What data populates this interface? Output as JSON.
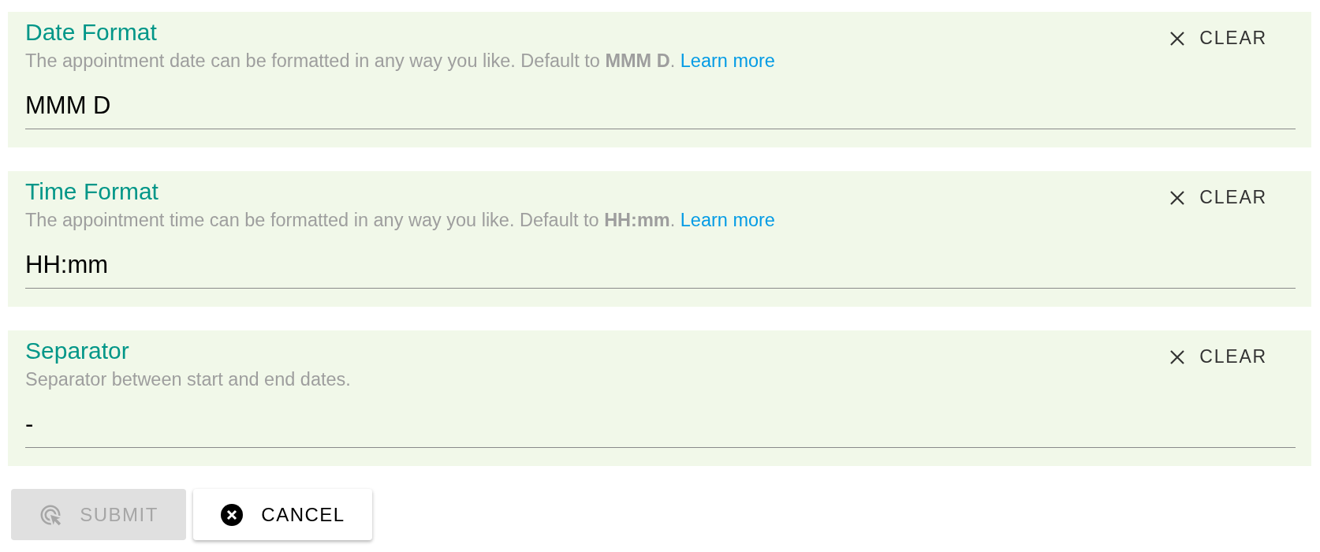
{
  "fields": [
    {
      "title": "Date Format",
      "description": "The appointment date can be formatted in any way you like. Default to **MMM D**.",
      "link": "Learn more",
      "value": "MMM D",
      "clear_label": "CLEAR"
    },
    {
      "title": "Time Format",
      "description": "The appointment time can be formatted in any way you like. Default to **HH:mm**.",
      "link": "Learn more",
      "value": "HH:mm",
      "clear_label": "CLEAR"
    },
    {
      "title": "Separator",
      "description": "Separator between start and end dates.",
      "value": "-",
      "clear_label": "CLEAR"
    }
  ],
  "buttons": [
    {
      "kind": "submit",
      "label": "SUBMIT",
      "disabled": true
    },
    {
      "kind": "cancel",
      "label": "CANCEL",
      "disabled": false
    }
  ]
}
